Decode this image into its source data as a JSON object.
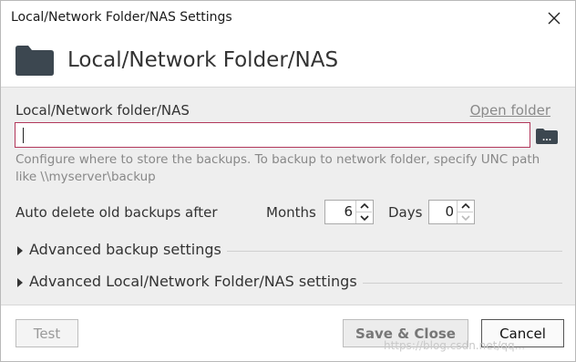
{
  "window": {
    "title": "Local/Network Folder/NAS Settings"
  },
  "header": {
    "title": "Local/Network Folder/NAS",
    "icon": "folder-icon",
    "icon_color": "#3c4750"
  },
  "folder": {
    "label": "Local/Network folder/NAS",
    "open_folder_label": "Open folder",
    "path_value": "",
    "browse_button_text": "...",
    "help_text": "Configure where to store the backups. To backup to network folder, specify UNC path like \\\\myserver\\backup"
  },
  "auto_delete": {
    "label": "Auto delete old backups after",
    "months_label": "Months",
    "months_value": "6",
    "days_label": "Days",
    "days_value": "0"
  },
  "sections": {
    "advanced_backup": "Advanced backup settings",
    "advanced_nas": "Advanced Local/Network Folder/NAS settings"
  },
  "footer": {
    "test_label": "Test",
    "save_close_label": "Save & Close",
    "cancel_label": "Cancel"
  },
  "watermark": "https://blog.csdn.net/qq..."
}
